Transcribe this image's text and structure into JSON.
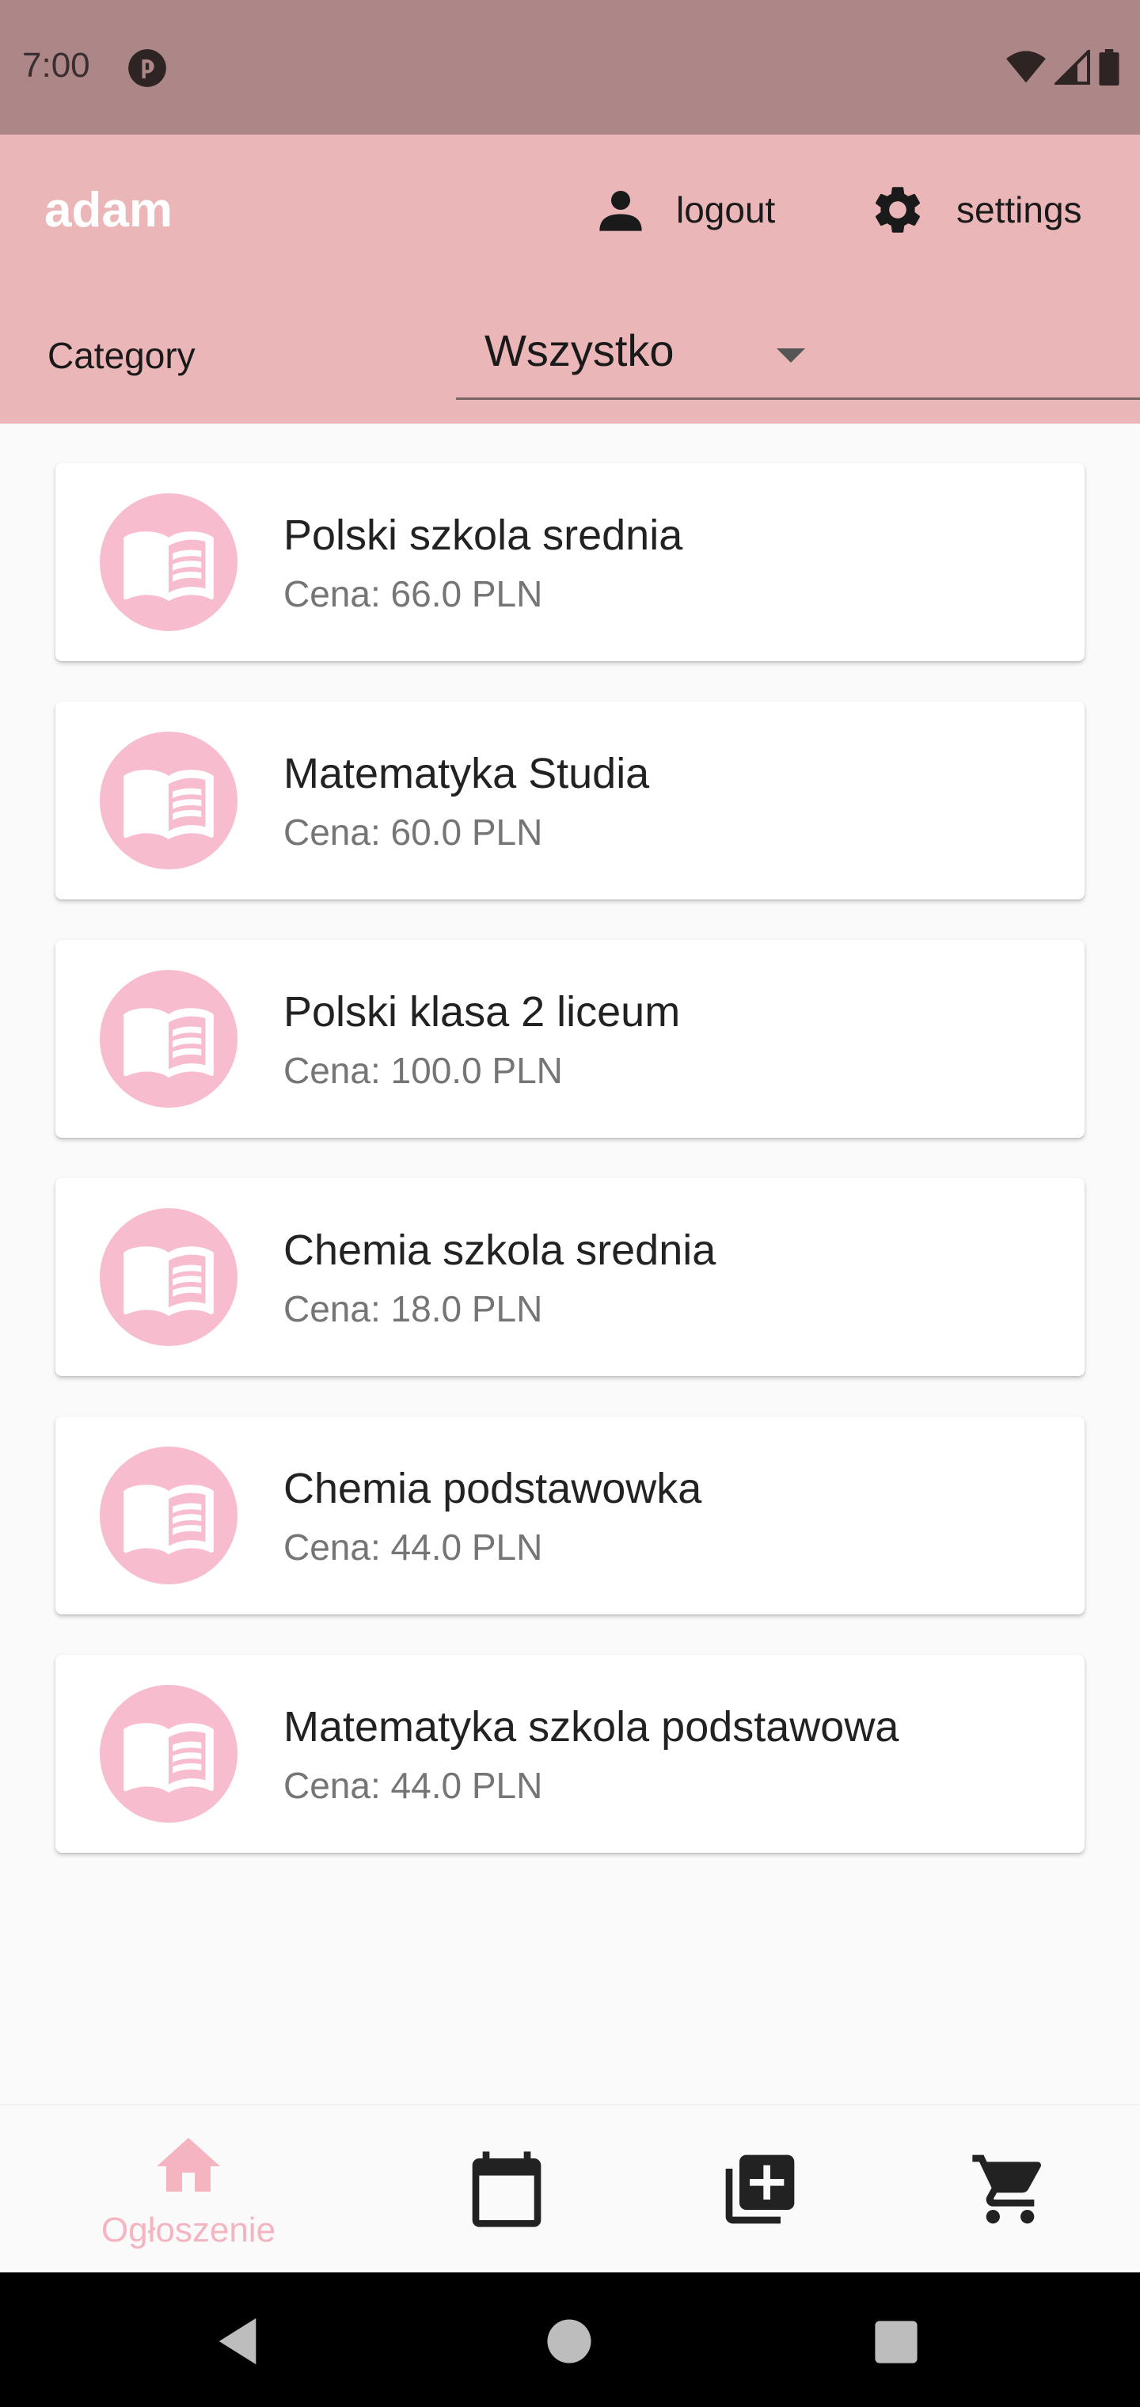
{
  "status_bar": {
    "time": "7:00"
  },
  "app_bar": {
    "user_name": "adam",
    "logout_label": "logout",
    "settings_label": "settings",
    "category_label": "Category",
    "category_value": "Wszystko"
  },
  "listings": [
    {
      "title": "Polski szkola srednia",
      "price": "Cena: 66.0 PLN"
    },
    {
      "title": "Matematyka Studia",
      "price": "Cena: 60.0 PLN"
    },
    {
      "title": "Polski klasa 2 liceum",
      "price": "Cena: 100.0 PLN"
    },
    {
      "title": "Chemia szkola srednia",
      "price": "Cena: 18.0 PLN"
    },
    {
      "title": "Chemia podstawowka",
      "price": "Cena: 44.0 PLN"
    },
    {
      "title": "Matematyka szkola podstawowa",
      "price": "Cena: 44.0 PLN"
    }
  ],
  "bottom_nav": {
    "active_label": "Ogłoszenie",
    "items": [
      {
        "icon": "home-icon",
        "label": "Ogłoszenie",
        "active": true
      },
      {
        "icon": "calendar-icon",
        "active": false
      },
      {
        "icon": "add-box-icon",
        "active": false
      },
      {
        "icon": "cart-icon",
        "active": false
      }
    ]
  },
  "colors": {
    "status_bar": "#ad8788",
    "app_bar": "#ebb6b8",
    "accent": "#f7bccd",
    "nav_active": "#f4b5c0"
  }
}
